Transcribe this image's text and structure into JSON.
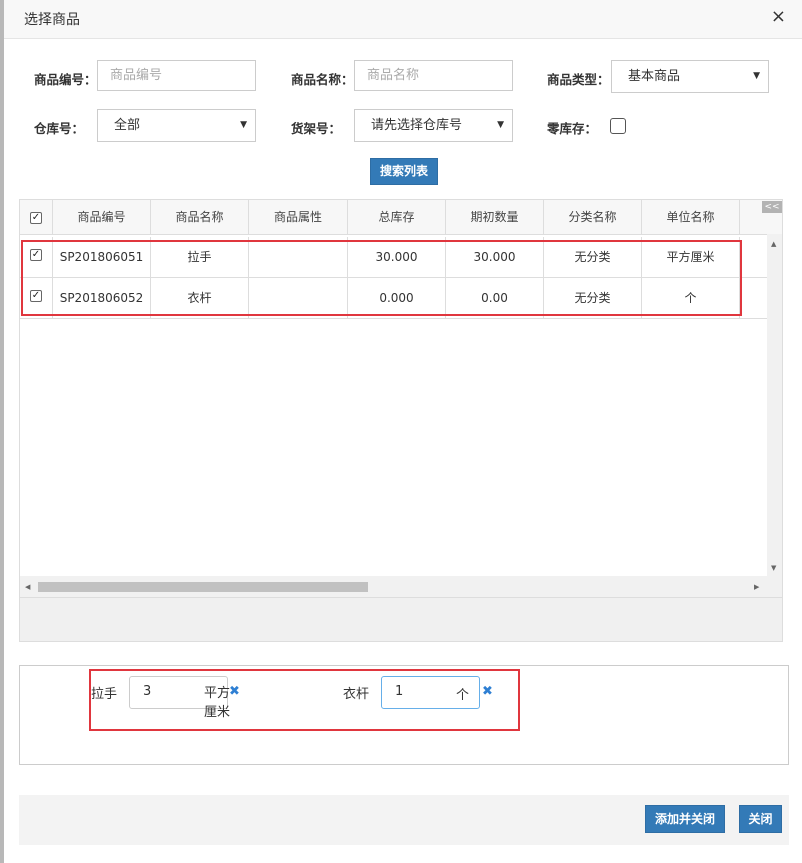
{
  "dialog": {
    "title": "选择商品",
    "close_glyph": "×"
  },
  "filters": {
    "code_label": "商品编号：",
    "code_placeholder": "商品编号",
    "name_label": "商品名称：",
    "name_placeholder": "商品名称",
    "type_label": "商品类型：",
    "type_value": "基本商品",
    "warehouse_label": "仓库号：",
    "warehouse_value": "全部",
    "shelf_label": "货架号：",
    "shelf_value": "请先选择仓库号",
    "zero_stock_label": "零库存：",
    "zero_stock_checked": false,
    "search_button": "搜索列表"
  },
  "table": {
    "collapse_label": "<<",
    "columns": [
      "商品编号",
      "商品名称",
      "商品属性",
      "总库存",
      "期初数量",
      "分类名称",
      "单位名称"
    ],
    "rows": [
      {
        "checked": true,
        "code": "SP201806051",
        "name": "拉手",
        "attr": "",
        "stock": "30.000",
        "initial": "30.000",
        "category": "无分类",
        "unit": "平方厘米"
      },
      {
        "checked": true,
        "code": "SP201806052",
        "name": "衣杆",
        "attr": "",
        "stock": "0.000",
        "initial": "0.00",
        "category": "无分类",
        "unit": "个"
      }
    ]
  },
  "selected": [
    {
      "name": "拉手",
      "qty": "3",
      "unit_line1": "平方",
      "unit_line2": "厘米"
    },
    {
      "name": "衣杆",
      "qty": "1",
      "unit": "个"
    }
  ],
  "footer": {
    "add_close_button": "添加并关闭",
    "close_button": "关闭"
  },
  "colors": {
    "primary": "#337ab7",
    "highlight": "#e0363e",
    "remove_icon": "#2e7fd3"
  }
}
